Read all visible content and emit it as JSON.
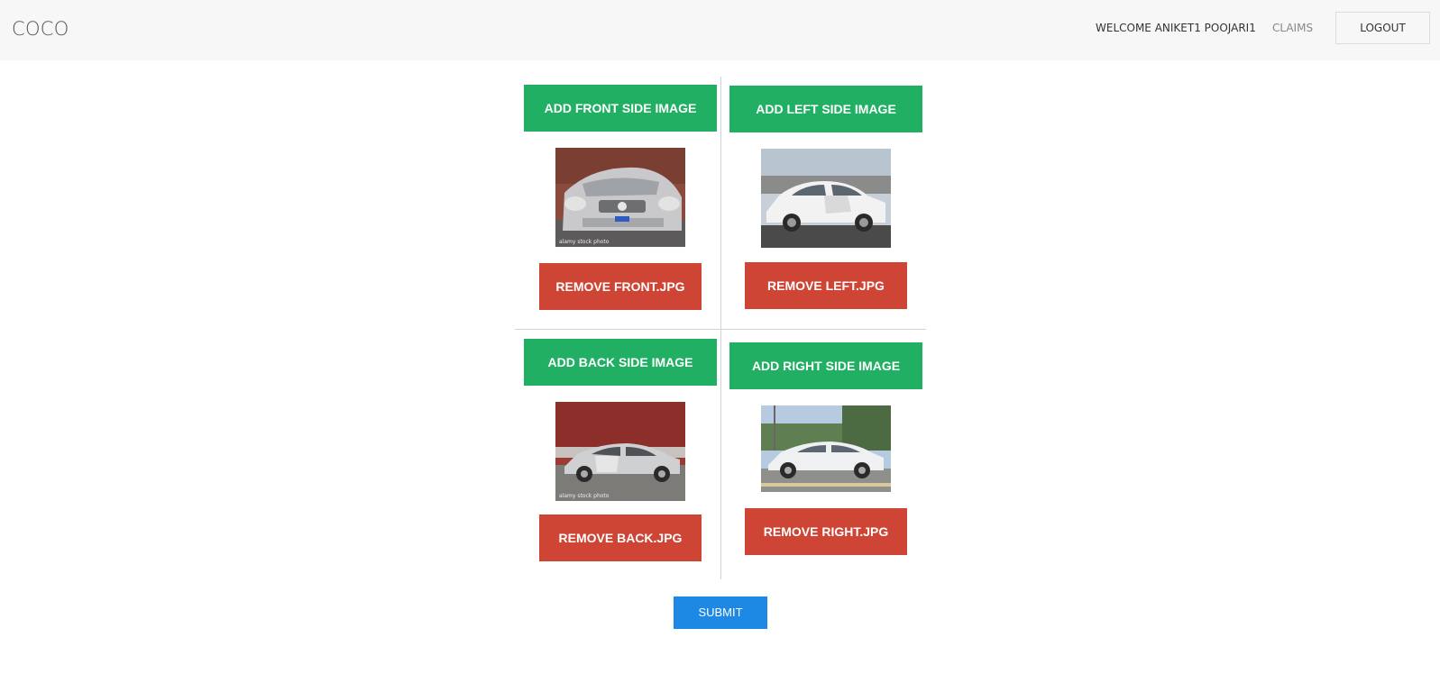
{
  "navbar": {
    "brand": "COCO",
    "welcome": "WELCOME ANIKET1 POOJARI1",
    "claims": "CLAIMS",
    "logout": "LOGOUT"
  },
  "panels": {
    "front": {
      "add_label": "ADD FRONT SIDE IMAGE",
      "remove_label": "REMOVE FRONT.JPG",
      "caption": "alamy stock photo"
    },
    "left": {
      "add_label": "ADD LEFT SIDE IMAGE",
      "remove_label": "REMOVE LEFT.JPG"
    },
    "back": {
      "add_label": "ADD BACK SIDE IMAGE",
      "remove_label": "REMOVE BACK.JPG",
      "caption": "alamy stock photo"
    },
    "right": {
      "add_label": "ADD RIGHT SIDE IMAGE",
      "remove_label": "REMOVE RIGHT.JPG"
    }
  },
  "submit_label": "SUBMIT",
  "colors": {
    "add_button": "#21b063",
    "remove_button": "#cf4535",
    "submit_button": "#1e88e5",
    "navbar_bg": "#f7f7f7"
  }
}
